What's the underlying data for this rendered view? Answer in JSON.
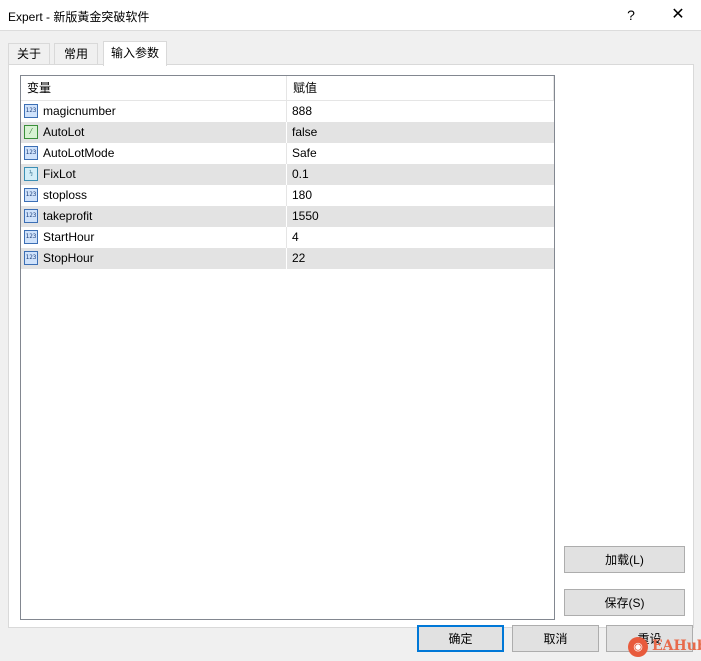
{
  "window": {
    "title": "Expert - 新版黃金突破软件",
    "help_glyph": "?",
    "close_glyph": "✕"
  },
  "tabs": [
    {
      "label": "关于"
    },
    {
      "label": "常用"
    },
    {
      "label": "输入参数"
    }
  ],
  "active_tab": "输入参数",
  "grid": {
    "columns": [
      "变量",
      "赋值"
    ],
    "rows": [
      {
        "name": "magicnumber",
        "value": "888",
        "icon": "int-icon",
        "glyph": "123"
      },
      {
        "name": "AutoLot",
        "value": "false",
        "icon": "bool-icon",
        "glyph": "⁄"
      },
      {
        "name": "AutoLotMode",
        "value": "Safe",
        "icon": "enum-icon",
        "glyph": "123"
      },
      {
        "name": "FixLot",
        "value": "0.1",
        "icon": "double-icon",
        "glyph": "½"
      },
      {
        "name": "stoploss",
        "value": "180",
        "icon": "int-icon",
        "glyph": "123"
      },
      {
        "name": "takeprofit",
        "value": "1550",
        "icon": "int-icon",
        "glyph": "123"
      },
      {
        "name": "StartHour",
        "value": "4",
        "icon": "int-icon",
        "glyph": "123"
      },
      {
        "name": "StopHour",
        "value": "22",
        "icon": "int-icon",
        "glyph": "123"
      }
    ]
  },
  "side_buttons": {
    "load": "加载(L)",
    "save": "保存(S)"
  },
  "bottom_buttons": {
    "ok": "确定",
    "cancel": "取消",
    "reset": "重设"
  },
  "watermark": {
    "badge": "◉",
    "text": "EAHub"
  }
}
